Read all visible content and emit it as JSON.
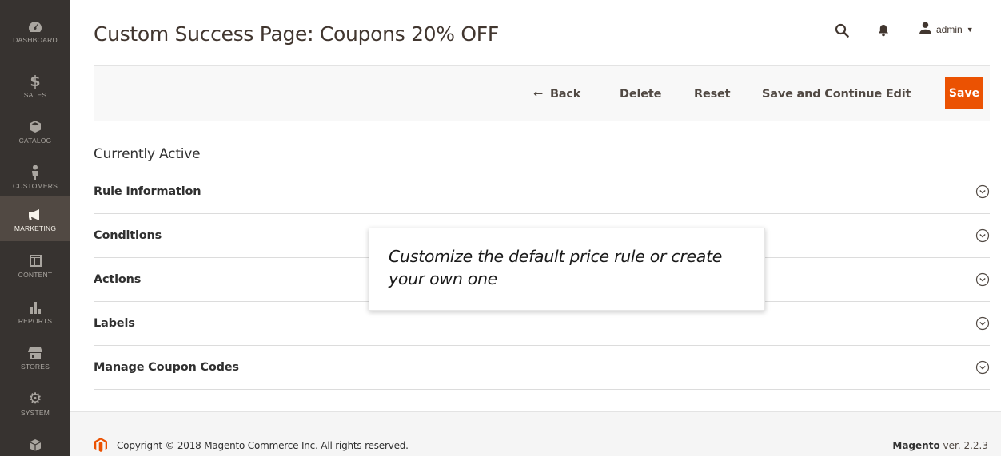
{
  "sidebar": {
    "items": [
      {
        "label": "DASHBOARD",
        "icon": "dashboard-icon"
      },
      {
        "label": "SALES",
        "icon": "dollar-icon"
      },
      {
        "label": "CATALOG",
        "icon": "cube-icon"
      },
      {
        "label": "CUSTOMERS",
        "icon": "person-icon"
      },
      {
        "label": "MARKETING",
        "icon": "megaphone-icon",
        "active": true
      },
      {
        "label": "CONTENT",
        "icon": "layout-icon"
      },
      {
        "label": "REPORTS",
        "icon": "bar-chart-icon"
      },
      {
        "label": "STORES",
        "icon": "store-icon"
      },
      {
        "label": "SYSTEM",
        "icon": "gear-icon"
      },
      {
        "label": "",
        "icon": "box-icon"
      }
    ]
  },
  "header": {
    "title": "Custom Success Page: Coupons 20% OFF",
    "user": "admin",
    "icons": [
      "search-icon",
      "bell-icon",
      "user-icon"
    ]
  },
  "actions": {
    "back": "Back",
    "delete": "Delete",
    "reset": "Reset",
    "save_continue": "Save and Continue Edit",
    "save": "Save"
  },
  "content": {
    "status": "Currently Active",
    "sections": [
      "Rule Information",
      "Conditions",
      "Actions",
      "Labels",
      "Manage Coupon Codes"
    ]
  },
  "tooltip": {
    "line1": "Customize the default price rule or create",
    "line2": "your own one"
  },
  "footer": {
    "copyright": "Copyright © 2018 Magento Commerce Inc. All rights reserved.",
    "brand": "Magento",
    "version": "ver. 2.2.3"
  },
  "colors": {
    "sidebar_bg": "#373330",
    "sidebar_active": "#514943",
    "accent": "#eb5202"
  }
}
